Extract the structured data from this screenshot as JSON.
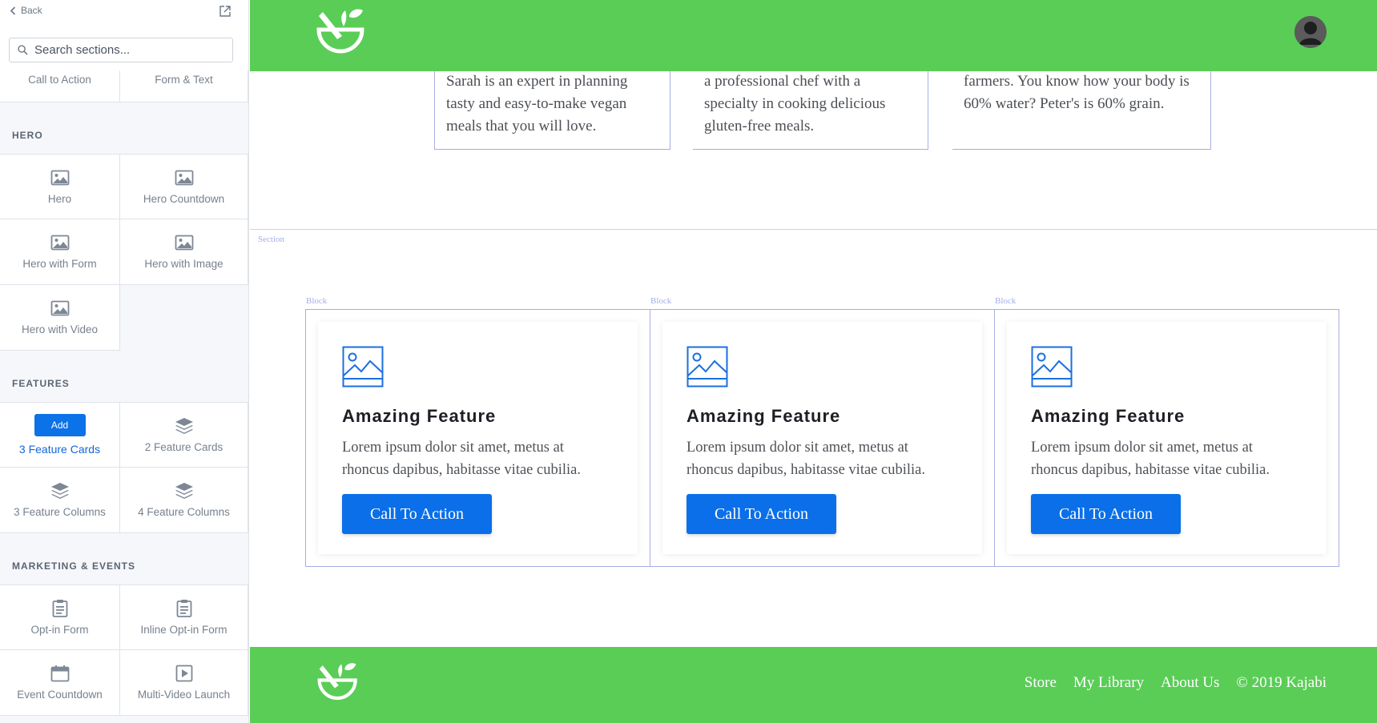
{
  "sidebar": {
    "back_label": "Back",
    "search_placeholder": "Search sections...",
    "partial_items": [
      "Call to Action",
      "Form & Text"
    ],
    "categories": [
      {
        "title": "HERO",
        "items": [
          "Hero",
          "Hero Countdown",
          "Hero with Form",
          "Hero with Image",
          "Hero with Video"
        ]
      },
      {
        "title": "FEATURES",
        "add_label": "Add",
        "items": [
          "3 Feature Cards",
          "2 Feature Cards",
          "3 Feature Columns",
          "4 Feature Columns"
        ]
      },
      {
        "title": "MARKETING & EVENTS",
        "items": [
          "Opt-in Form",
          "Inline Opt-in Form",
          "Event Countdown",
          "Multi-Video Launch"
        ]
      }
    ]
  },
  "canvas": {
    "team_texts": [
      "Sarah is an expert in planning tasty and easy-to-make vegan meals that you will love.",
      "a professional chef with a specialty in cooking delicious gluten-free meals.",
      "farmers. You know how your body is 60% water? Peter's is 60% grain."
    ],
    "section_label": "Section",
    "block_label": "Block",
    "cards": [
      {
        "title": "Amazing Feature",
        "body": "Lorem ipsum dolor sit amet, metus at rhoncus dapibus, habitasse vitae cubilia.",
        "cta": "Call To Action"
      },
      {
        "title": "Amazing Feature",
        "body": "Lorem ipsum dolor sit amet, metus at rhoncus dapibus, habitasse vitae cubilia.",
        "cta": "Call To Action"
      },
      {
        "title": "Amazing Feature",
        "body": "Lorem ipsum dolor sit amet, metus at rhoncus dapibus, habitasse vitae cubilia.",
        "cta": "Call To Action"
      }
    ],
    "footer": {
      "links": [
        "Store",
        "My Library",
        "About Us"
      ],
      "copyright": "© 2019 Kajabi"
    }
  },
  "colors": {
    "brand_green": "#5acd56",
    "primary_blue": "#0a6fe9",
    "outline_lavender": "#a7aee3"
  },
  "icons": {
    "image": "image-icon",
    "layers": "layers-icon",
    "clipboard": "clipboard-icon",
    "calendar": "calendar-icon",
    "video": "video-icon"
  }
}
